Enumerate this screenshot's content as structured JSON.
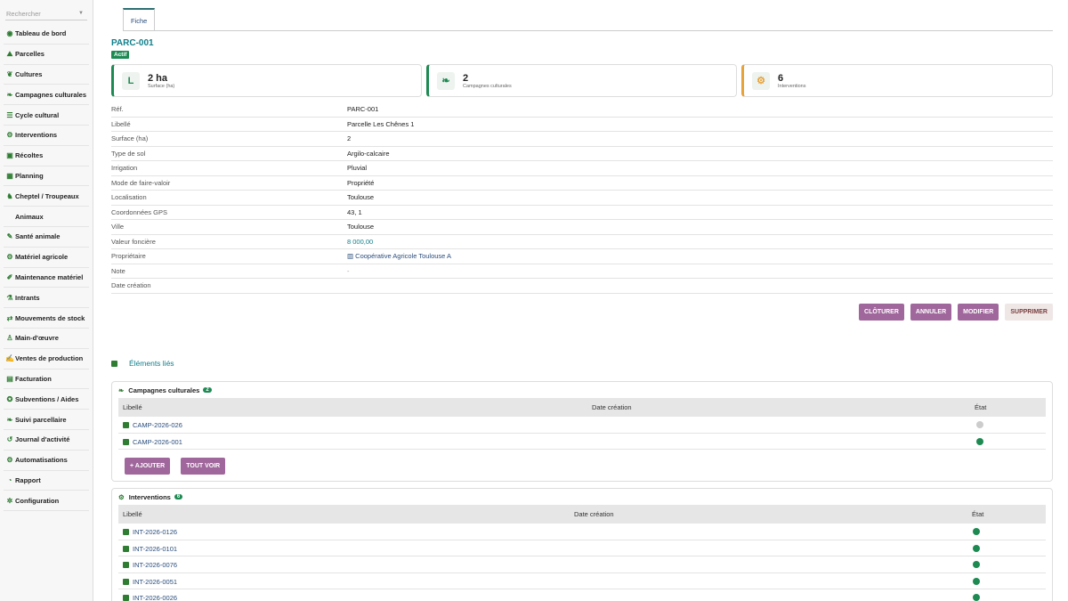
{
  "search": {
    "placeholder": "Rechercher"
  },
  "sidebar": {
    "items": [
      {
        "label": "Tableau de bord",
        "icon": "dashboard-icon",
        "glyph": "◉"
      },
      {
        "label": "Parcelles",
        "icon": "parcel-icon",
        "glyph": "⛰"
      },
      {
        "label": "Cultures",
        "icon": "sprout-icon",
        "glyph": "❦"
      },
      {
        "label": "Campagnes culturales",
        "icon": "leaf-icon",
        "glyph": "❧"
      },
      {
        "label": "Cycle cultural",
        "icon": "list-icon",
        "glyph": "☰"
      },
      {
        "label": "Interventions",
        "icon": "tractor-icon",
        "glyph": "⚙"
      },
      {
        "label": "Récoltes",
        "icon": "harvest-icon",
        "glyph": "▣"
      },
      {
        "label": "Planning",
        "icon": "calendar-icon",
        "glyph": "▦"
      },
      {
        "label": "Cheptel / Troupeaux",
        "icon": "herd-icon",
        "glyph": "♞"
      },
      {
        "label": "Animaux",
        "icon": "",
        "glyph": ""
      },
      {
        "label": "Santé animale",
        "icon": "syringe-icon",
        "glyph": "✎"
      },
      {
        "label": "Matériel agricole",
        "icon": "equipment-icon",
        "glyph": "⚙"
      },
      {
        "label": "Maintenance matériel",
        "icon": "wrench-icon",
        "glyph": "✐"
      },
      {
        "label": "Intrants",
        "icon": "input-icon",
        "glyph": "⚗"
      },
      {
        "label": "Mouvements de stock",
        "icon": "exchange-icon",
        "glyph": "⇄"
      },
      {
        "label": "Main-d'œuvre",
        "icon": "worker-icon",
        "glyph": "♙"
      },
      {
        "label": "Ventes de production",
        "icon": "sales-icon",
        "glyph": "✍"
      },
      {
        "label": "Facturation",
        "icon": "invoice-icon",
        "glyph": "▤"
      },
      {
        "label": "Subventions / Aides",
        "icon": "grant-icon",
        "glyph": "✪"
      },
      {
        "label": "Suivi parcellaire",
        "icon": "tracking-icon",
        "glyph": "❧"
      },
      {
        "label": "Journal d'activité",
        "icon": "history-icon",
        "glyph": "↺"
      },
      {
        "label": "Automatisations",
        "icon": "robot-icon",
        "glyph": "⚙"
      },
      {
        "label": "Rapport",
        "icon": "report-icon",
        "glyph": "◔"
      },
      {
        "label": "Configuration",
        "icon": "gear-icon",
        "glyph": "✲"
      }
    ]
  },
  "tabs": {
    "fiche": "Fiche"
  },
  "record": {
    "ref": "PARC-001",
    "status": "Actif"
  },
  "stats": [
    {
      "value": "2 ha",
      "label": "Surface (ha)",
      "icon": "surface-icon",
      "glyph": "L",
      "color": "#1d8a52"
    },
    {
      "value": "2",
      "label": "Campagnes culturales",
      "icon": "leaf-icon",
      "glyph": "❧",
      "color": "#1d8a52"
    },
    {
      "value": "6",
      "label": "Interventions",
      "icon": "tractor-icon",
      "glyph": "⚙",
      "color": "#e8a23a"
    }
  ],
  "details": [
    {
      "key": "Réf.",
      "value": "PARC-001"
    },
    {
      "key": "Libellé",
      "value": "Parcelle Les Chênes 1"
    },
    {
      "key": "Surface (ha)",
      "value": "2"
    },
    {
      "key": "Type de sol",
      "value": "Argilo-calcaire"
    },
    {
      "key": "Irrigation",
      "value": "Pluvial"
    },
    {
      "key": "Mode de faire-valoir",
      "value": "Propriété"
    },
    {
      "key": "Localisation",
      "value": "Toulouse"
    },
    {
      "key": "Coordonnées GPS",
      "value": "43, 1"
    },
    {
      "key": "Ville",
      "value": "Toulouse"
    },
    {
      "key": "Valeur foncière",
      "value": "8 000,00"
    },
    {
      "key": "Propriétaire",
      "value": "Coopérative Agricole Toulouse A"
    },
    {
      "key": "Note",
      "value": "-"
    },
    {
      "key": "Date création",
      "value": ""
    }
  ],
  "actions": {
    "cloturer": "CLÔTURER",
    "annuler": "ANNULER",
    "modifier": "MODIFIER",
    "supprimer": "SUPPRIMER"
  },
  "linked": {
    "title": "Éléments liés"
  },
  "campagnes": {
    "title": "Campagnes culturales",
    "count": "2",
    "columns": {
      "libelle": "Libellé",
      "date": "Date création",
      "etat": "État"
    },
    "rows": [
      {
        "label": "CAMP-2026-026",
        "status_color": "#cccccc"
      },
      {
        "label": "CAMP-2026-001",
        "status_color": "#1d8a52"
      }
    ],
    "add_label": "+ AJOUTER",
    "view_all_label": "TOUT VOIR"
  },
  "interventions": {
    "title": "Interventions",
    "count": "6",
    "columns": {
      "libelle": "Libellé",
      "date": "Date création",
      "etat": "État"
    },
    "rows": [
      {
        "label": "INT-2026-0126",
        "status_color": "#1d8a52"
      },
      {
        "label": "INT-2026-0101",
        "status_color": "#1d8a52"
      },
      {
        "label": "INT-2026-0076",
        "status_color": "#1d8a52"
      },
      {
        "label": "INT-2026-0051",
        "status_color": "#1d8a52"
      },
      {
        "label": "INT-2026-0026",
        "status_color": "#1d8a52"
      }
    ]
  }
}
